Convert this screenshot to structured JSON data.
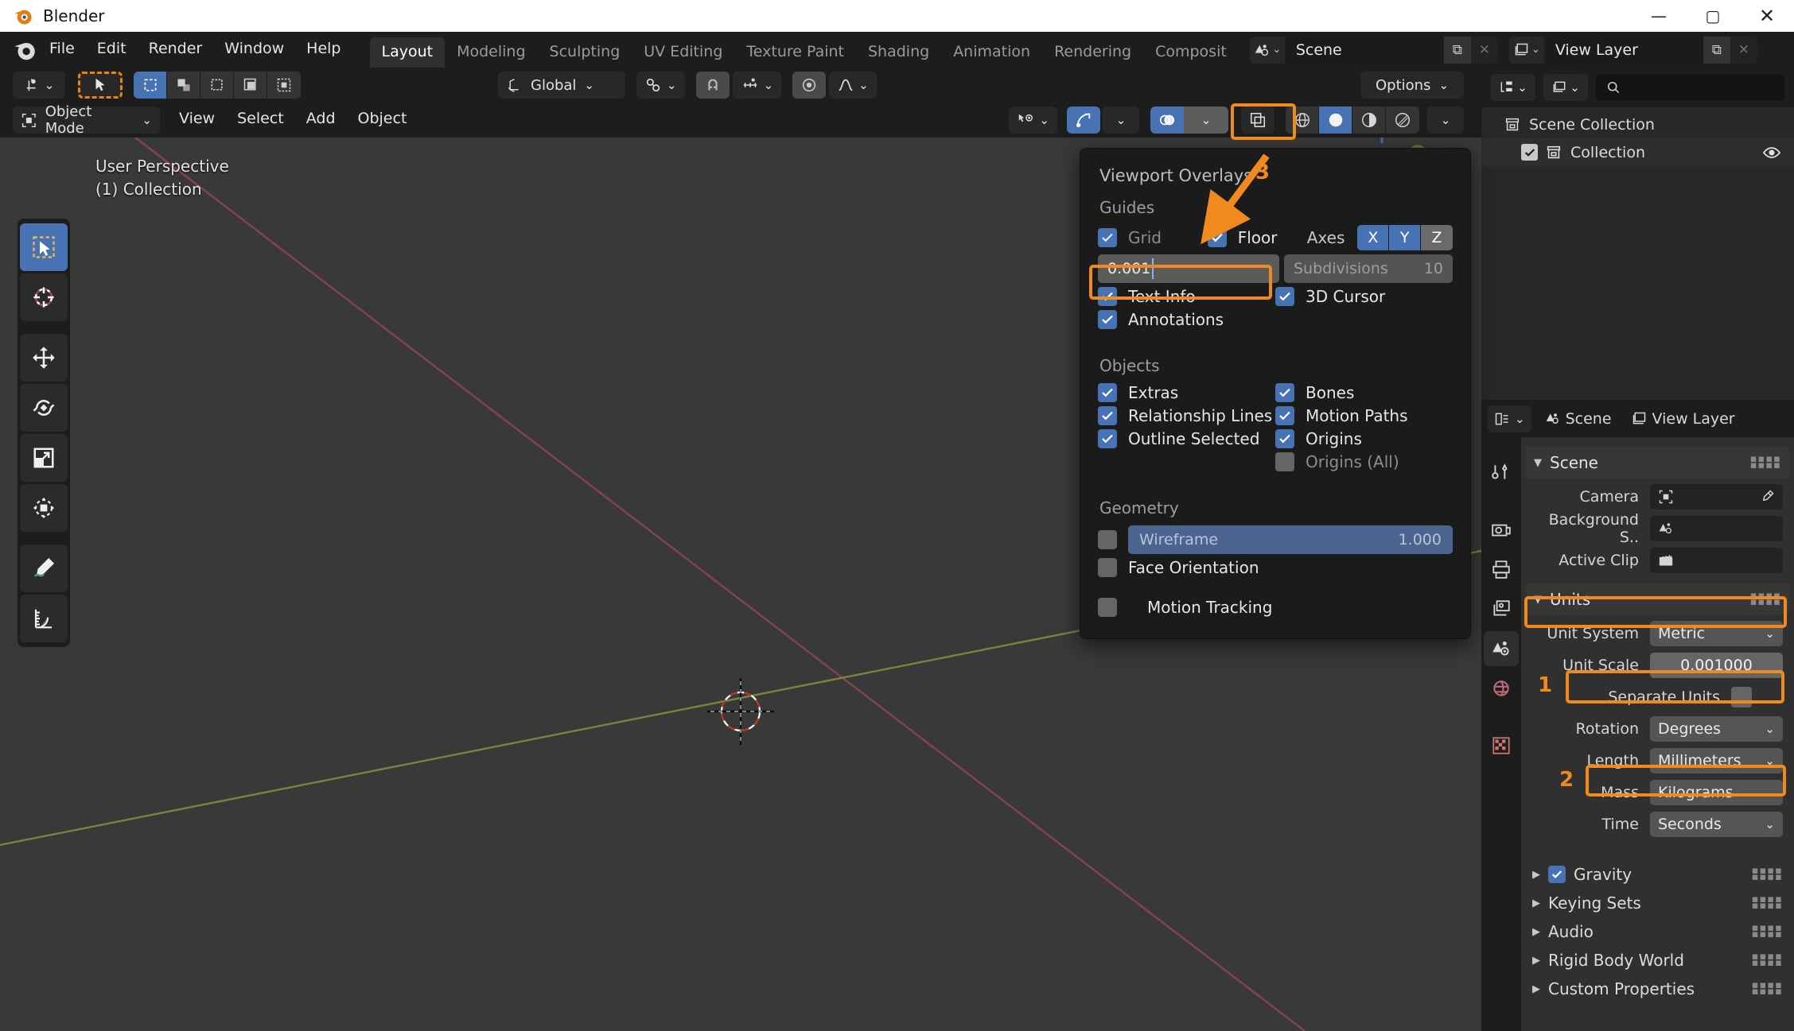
{
  "window": {
    "app_title": "Blender",
    "controls": {
      "minimize": "—",
      "maximize": "▢",
      "close": "✕"
    }
  },
  "topbar": {
    "menus": [
      "File",
      "Edit",
      "Render",
      "Window",
      "Help"
    ],
    "workspace_tabs": [
      {
        "label": "Layout",
        "active": true
      },
      {
        "label": "Modeling",
        "active": false
      },
      {
        "label": "Sculpting",
        "active": false
      },
      {
        "label": "UV Editing",
        "active": false
      },
      {
        "label": "Texture Paint",
        "active": false
      },
      {
        "label": "Shading",
        "active": false
      },
      {
        "label": "Animation",
        "active": false
      },
      {
        "label": "Rendering",
        "active": false
      },
      {
        "label": "Composit",
        "active": false
      }
    ],
    "scene_datablock": {
      "name": "Scene",
      "new_btn": "⧉",
      "unlink_btn": "✕"
    },
    "viewlayer_datablock": {
      "name": "View Layer",
      "new_btn": "⧉",
      "unlink_btn": "✕"
    }
  },
  "viewport": {
    "header_top": {
      "options_label": "Options"
    },
    "header_mid": {
      "transform_orientation": "Global",
      "mode": "Object Mode",
      "menus": [
        "View",
        "Select",
        "Add",
        "Object"
      ]
    },
    "text_info": {
      "line1": "User Perspective",
      "line2": "(1) Collection"
    },
    "toolbar_tools": [
      "tweak-select-tool",
      "cursor-tool",
      "move-tool",
      "rotate-tool",
      "scale-tool",
      "transform-tool",
      "annotate-tool",
      "measure-tool"
    ]
  },
  "overlay_popover": {
    "title": "Viewport Overlays",
    "guides": {
      "section_label": "Guides",
      "grid": {
        "label": "Grid",
        "checked": true,
        "enabled": false
      },
      "floor": {
        "label": "Floor",
        "checked": true,
        "enabled": true
      },
      "axes_label": "Axes",
      "axes": [
        {
          "label": "X",
          "on": true
        },
        {
          "label": "Y",
          "on": true
        },
        {
          "label": "Z",
          "on": false
        }
      ],
      "grid_scale_value": "0.001",
      "subdivisions_label": "Subdivisions",
      "subdivisions_value": "10",
      "text_info": {
        "label": "Text Info",
        "checked": true
      },
      "cursor_3d": {
        "label": "3D Cursor",
        "checked": true
      },
      "annotations": {
        "label": "Annotations",
        "checked": true
      }
    },
    "objects": {
      "section_label": "Objects",
      "items": [
        {
          "label": "Extras",
          "checked": true,
          "dim": false
        },
        {
          "label": "Relationship Lines",
          "checked": true,
          "dim": false
        },
        {
          "label": "Outline Selected",
          "checked": true,
          "dim": false
        },
        {
          "label": "Bones",
          "checked": true,
          "dim": false
        },
        {
          "label": "Motion Paths",
          "checked": true,
          "dim": false
        },
        {
          "label": "Origins",
          "checked": true,
          "dim": false
        },
        {
          "label": "Origins (All)",
          "checked": false,
          "dim": true
        }
      ]
    },
    "geometry": {
      "section_label": "Geometry",
      "wireframe": {
        "label": "Wireframe",
        "checked": false,
        "value": "1.000"
      },
      "face_orientation": {
        "label": "Face Orientation",
        "checked": false
      },
      "motion_tracking": {
        "label": "Motion Tracking",
        "checked": false
      }
    }
  },
  "annotations": {
    "step1": "1",
    "step2": "2",
    "step3": "3",
    "highlight_color": "#f08a1e"
  },
  "outliner": {
    "search_placeholder": "",
    "rows": [
      {
        "label": "Scene Collection",
        "indent": 0,
        "checkbox": false,
        "eye": false
      },
      {
        "label": "Collection",
        "indent": 1,
        "checkbox": true,
        "eye": true
      }
    ]
  },
  "properties": {
    "breadcrumb": {
      "scene": "Scene",
      "view_layer": "View Layer"
    },
    "scene_panel": {
      "title": "Scene"
    },
    "scene_fields": [
      {
        "label": "Camera",
        "type": "id",
        "value": ""
      },
      {
        "label": "Background S..",
        "type": "id",
        "value": ""
      },
      {
        "label": "Active Clip",
        "type": "id",
        "value": ""
      }
    ],
    "units_panel": {
      "title": "Units"
    },
    "units_fields": [
      {
        "label": "Unit System",
        "value": "Metric",
        "type": "select"
      },
      {
        "label": "Unit Scale",
        "value": "0.001000",
        "type": "number"
      },
      {
        "label": "Separate Units",
        "value": "",
        "type": "check"
      },
      {
        "label": "Rotation",
        "value": "Degrees",
        "type": "select"
      },
      {
        "label": "Length",
        "value": "Millimeters",
        "type": "select"
      },
      {
        "label": "Mass",
        "value": "Kilograms",
        "type": "select"
      },
      {
        "label": "Time",
        "value": "Seconds",
        "type": "select"
      }
    ],
    "collapsed_panels": [
      {
        "label": "Gravity",
        "checkbox": true
      },
      {
        "label": "Keying Sets",
        "checkbox": false
      },
      {
        "label": "Audio",
        "checkbox": false
      },
      {
        "label": "Rigid Body World",
        "checkbox": false
      },
      {
        "label": "Custom Properties",
        "checkbox": false
      }
    ]
  }
}
